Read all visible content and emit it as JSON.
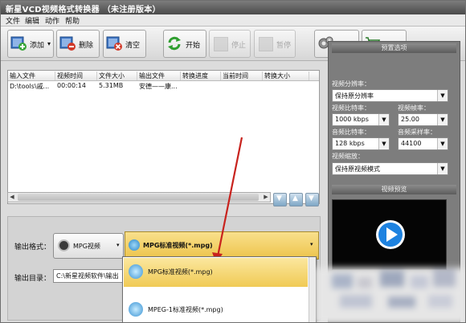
{
  "window": {
    "title": "新星VCD视频格式转换器 （未注册版本）"
  },
  "menu": [
    "文件",
    "编辑",
    "动作",
    "帮助"
  ],
  "toolbar": {
    "add": "添加",
    "delete": "删除",
    "clear": "清空",
    "start": "开始",
    "stop": "停止",
    "pause": "暂停",
    "options": "选项",
    "buy": "购买"
  },
  "file_list": {
    "columns": [
      "输入文件",
      "视频时间",
      "文件大小",
      "输出文件",
      "转换进度",
      "当前时间",
      "转换大小"
    ],
    "rows": [
      [
        "D:\\tools\\戚...",
        "00:00:14",
        "5.31MB",
        "安德——康...",
        "",
        "",
        ""
      ]
    ]
  },
  "output": {
    "format_label": "输出格式：",
    "format_category": "MPG视频",
    "format_value": "MPG标准视频(*.mpg)",
    "dir_label": "输出目录：",
    "dir_value": "C:\\新星视频软件\\输出"
  },
  "dropdown_options": [
    "MPG标准视频(*.mpg)",
    "MPEG-1标准视频(*.mpg)"
  ],
  "settings": {
    "section_title": "预置选项",
    "video_resolution_label": "视频分辨率：",
    "video_resolution_value": "保持原分辨率",
    "video_bitrate_label": "视频比特率：",
    "video_bitrate_value": "1000 kbps",
    "framerate_label": "视频帧率：",
    "framerate_value": "25.00",
    "audio_bitrate_label": "音频比特率：",
    "audio_bitrate_value": "128 kbps",
    "samplerate_label": "音频采样率：",
    "samplerate_value": "44100",
    "video_scale_label": "视频缩放：",
    "video_scale_value": "保持原视频模式"
  },
  "preview": {
    "title": "视频预览"
  },
  "colors": {
    "accent_yellow": "#f3cf55",
    "arrow_red": "#c8231e",
    "play_blue": "#1d82e0",
    "panel_gray": "#7d7d7d"
  },
  "icons": {
    "add": "film-plus-icon",
    "delete": "film-minus-icon",
    "clear": "film-clear-icon",
    "start": "refresh-green-icon",
    "options": "gears-icon",
    "buy": "cart-icon",
    "play": "play-icon"
  }
}
